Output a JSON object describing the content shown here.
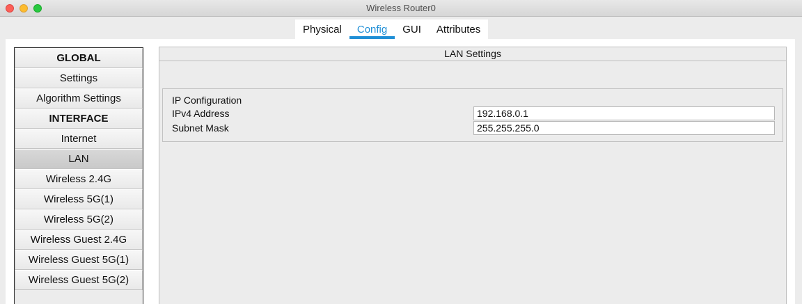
{
  "window": {
    "title": "Wireless Router0"
  },
  "tabs": [
    {
      "label": "Physical"
    },
    {
      "label": "Config"
    },
    {
      "label": "GUI"
    },
    {
      "label": "Attributes"
    }
  ],
  "sidebar": {
    "items": [
      {
        "label": "GLOBAL"
      },
      {
        "label": "Settings"
      },
      {
        "label": "Algorithm Settings"
      },
      {
        "label": "INTERFACE"
      },
      {
        "label": "Internet"
      },
      {
        "label": "LAN"
      },
      {
        "label": "Wireless 2.4G"
      },
      {
        "label": "Wireless 5G(1)"
      },
      {
        "label": "Wireless 5G(2)"
      },
      {
        "label": "Wireless Guest 2.4G"
      },
      {
        "label": "Wireless Guest 5G(1)"
      },
      {
        "label": "Wireless Guest 5G(2)"
      }
    ],
    "selected": "LAN"
  },
  "content": {
    "title": "LAN Settings",
    "ip_config": {
      "title": "IP Configuration",
      "ipv4_label": "IPv4 Address",
      "ipv4_value": "192.168.0.1",
      "mask_label": "Subnet Mask",
      "mask_value": "255.255.255.0"
    }
  },
  "colors": {
    "accent": "#1f8fd6"
  }
}
